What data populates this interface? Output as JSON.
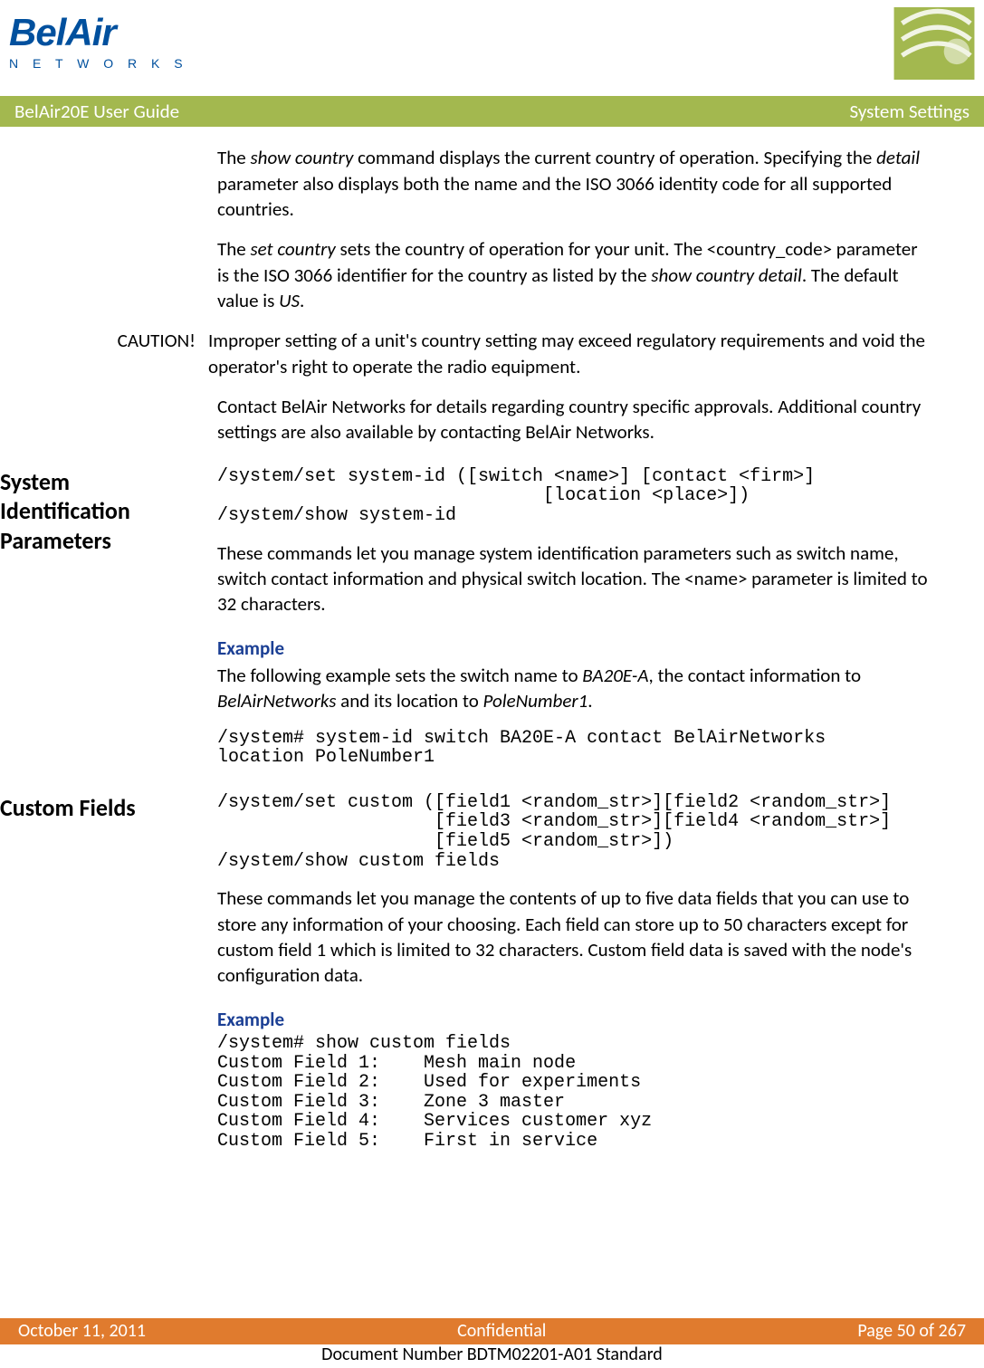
{
  "logo": {
    "brand": "BelAir",
    "sub": "N E T W O R K S"
  },
  "titlebar": {
    "left": "BelAir20E User Guide",
    "right": "System Settings"
  },
  "s1": {
    "p1a": "The ",
    "p1b": "show country",
    "p1c": " command displays the current country of operation. Specifying the ",
    "p1d": "detail",
    "p1e": " parameter also displays both the name and the ISO 3066 identity code for all supported countries.",
    "p2a": "The ",
    "p2b": "set country",
    "p2c": " sets the country of operation for your unit. The <country_code> parameter is the ISO 3066 identifier for the country as listed by the ",
    "p2d": "show country detail",
    "p2e": ". The default value is ",
    "p2f": "US",
    "p2g": "."
  },
  "caution": {
    "label": "CAUTION!",
    "text": "Improper setting of a unit's country setting may exceed regulatory requirements and void the operator's right to operate the radio equipment."
  },
  "s1b": {
    "p1": "Contact BelAir Networks for details regarding country specific approvals. Additional country settings are also available by contacting BelAir Networks."
  },
  "sysid": {
    "heading": "System Identification Parameters",
    "code": "/system/set system-id ([switch <name>] [contact <firm>]\n                              [location <place>])\n/system/show system-id",
    "para": "These commands let you manage system identification parameters such as switch name, switch contact information and physical switch location. The <name> parameter is limited to 32 characters.",
    "exlabel": "Example",
    "exa": "The following example sets the switch name to ",
    "exb": "BA20E-A",
    "exc": ", the contact information to ",
    "exd": "BelAirNetworks",
    "exe": " and its location to ",
    "exf": "PoleNumber1",
    "exg": ".",
    "excode": "/system# system-id switch BA20E-A contact BelAirNetworks\nlocation PoleNumber1"
  },
  "custom": {
    "heading": "Custom Fields",
    "code": "/system/set custom ([field1 <random_str>][field2 <random_str>]\n                    [field3 <random_str>][field4 <random_str>]\n                    [field5 <random_str>])\n/system/show custom fields",
    "para": "These commands let you manage the contents of up to five data fields that you can use to store any information of your choosing. Each field can store up to 50 characters except for custom field 1 which is limited to 32 characters. Custom field data is saved with the node's configuration data.",
    "exlabel": "Example",
    "excode": "/system# show custom fields\nCustom Field 1:    Mesh main node\nCustom Field 2:    Used for experiments\nCustom Field 3:    Zone 3 master\nCustom Field 4:    Services customer xyz\nCustom Field 5:    First in service"
  },
  "footer": {
    "date": "October 11, 2011",
    "center": "Confidential",
    "page": "Page 50 of 267",
    "docnum": "Document Number BDTM02201-A01 Standard"
  }
}
